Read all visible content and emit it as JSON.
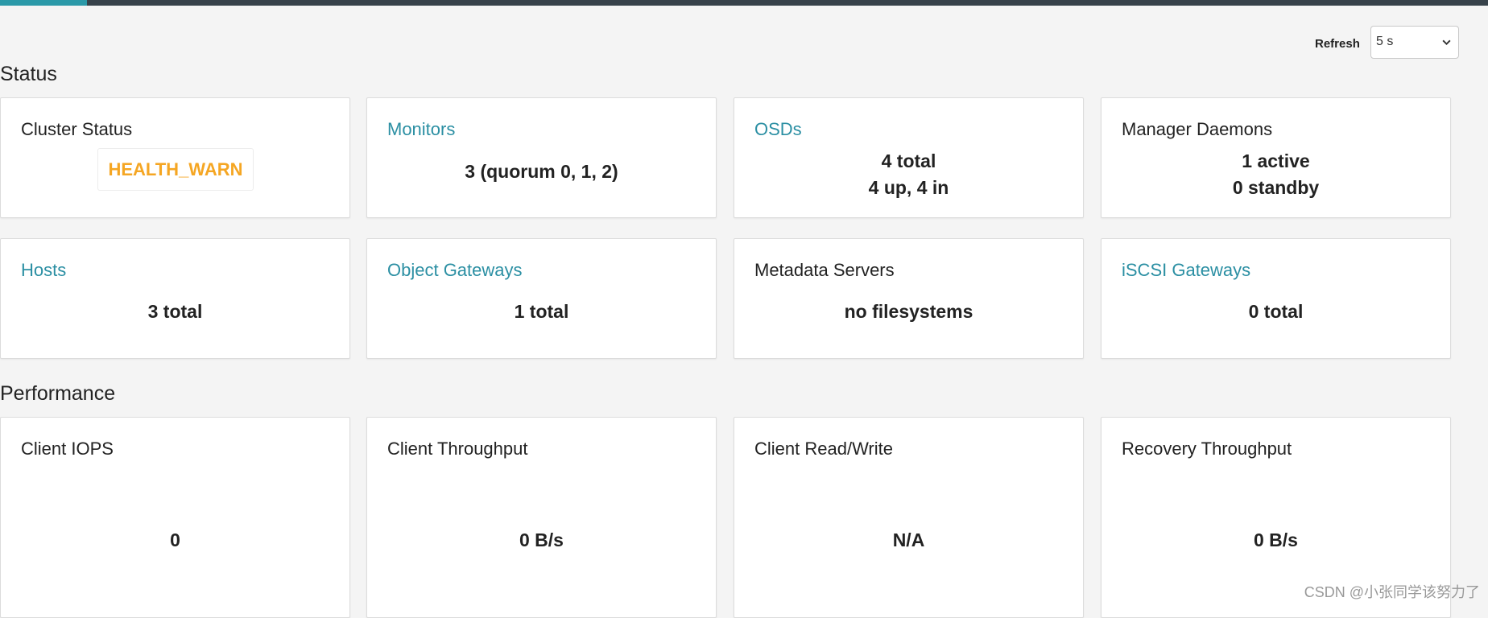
{
  "toolbar": {
    "refresh_label": "Refresh",
    "refresh_interval": "5 s"
  },
  "sections": {
    "status": "Status",
    "performance": "Performance"
  },
  "status_cards": {
    "cluster_status": {
      "title": "Cluster Status",
      "value": "HEALTH_WARN",
      "value_color": "#f5a623"
    },
    "monitors": {
      "title": "Monitors",
      "value": "3 (quorum 0, 1, 2)"
    },
    "osds": {
      "title": "OSDs",
      "line1": "4 total",
      "line2": "4 up, 4 in"
    },
    "manager_daemons": {
      "title": "Manager Daemons",
      "line1": "1 active",
      "line2": "0 standby"
    },
    "hosts": {
      "title": "Hosts",
      "value": "3 total"
    },
    "object_gateways": {
      "title": "Object Gateways",
      "value": "1 total"
    },
    "metadata_servers": {
      "title": "Metadata Servers",
      "value": "no filesystems"
    },
    "iscsi_gateways": {
      "title": "iSCSI Gateways",
      "value": "0 total"
    }
  },
  "performance_cards": {
    "client_iops": {
      "title": "Client IOPS",
      "value": "0"
    },
    "client_throughput": {
      "title": "Client Throughput",
      "value": "0 B/s"
    },
    "client_read_write": {
      "title": "Client Read/Write",
      "value": "N/A"
    },
    "recovery_throughput": {
      "title": "Recovery Throughput",
      "value": "0 B/s"
    }
  },
  "watermark": "CSDN @小张同学该努力了",
  "colors": {
    "link": "#2b8fa3",
    "warn": "#f5a623",
    "topbar": "#37424a",
    "topbar_active": "#2b99a8"
  }
}
